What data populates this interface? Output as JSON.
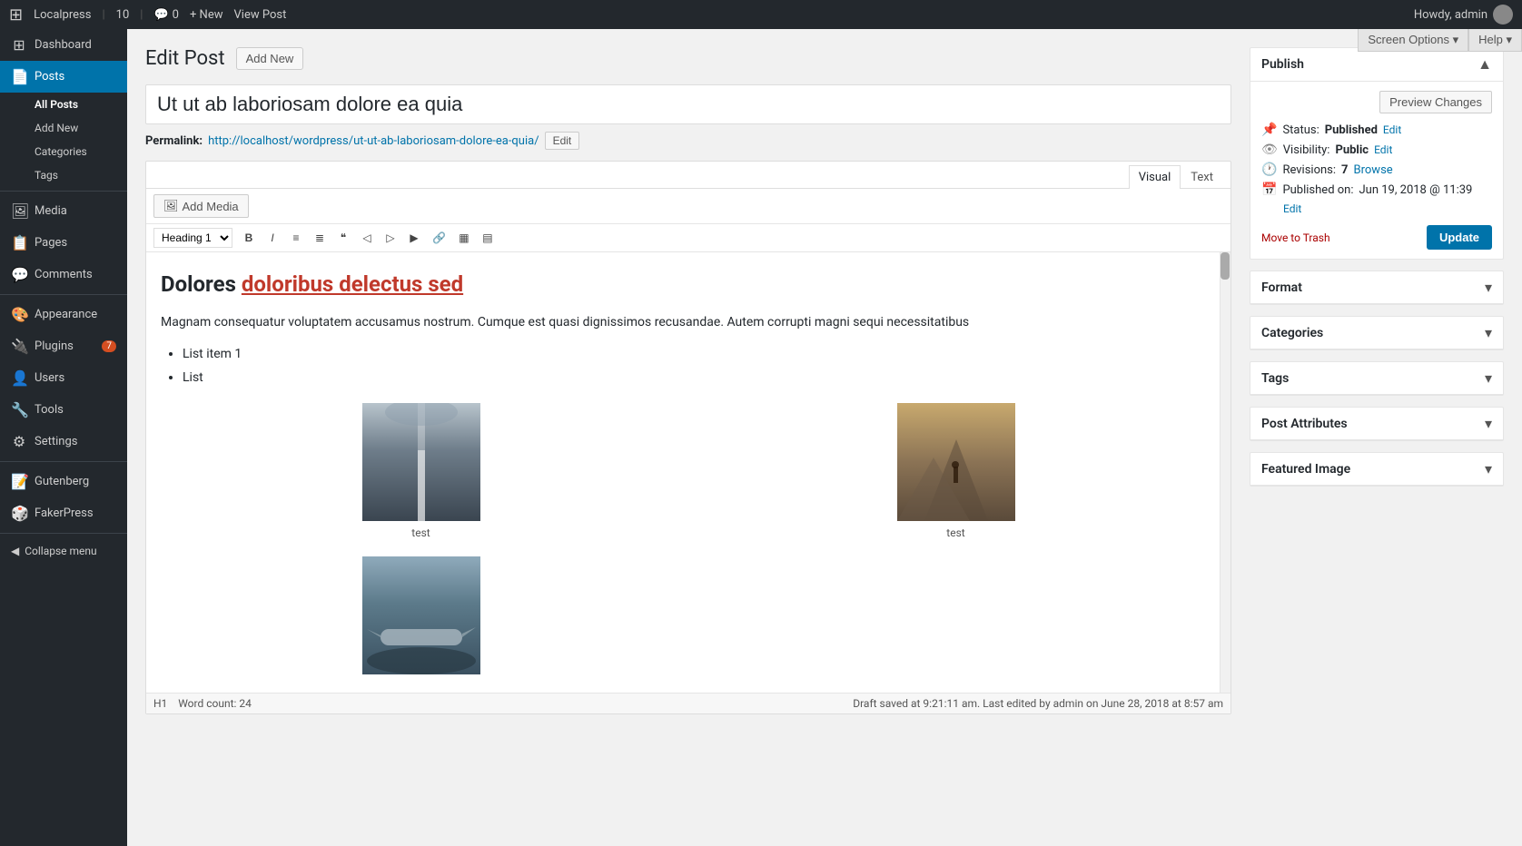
{
  "adminbar": {
    "site_name": "Localpress",
    "update_count": "10",
    "comment_count": "0",
    "new_label": "+ New",
    "view_post_label": "View Post",
    "howdy_label": "Howdy, admin"
  },
  "screen_options": {
    "label": "Screen Options ▾",
    "help_label": "Help ▾"
  },
  "sidebar": {
    "items": [
      {
        "id": "dashboard",
        "label": "Dashboard",
        "icon": "⊞"
      },
      {
        "id": "posts",
        "label": "Posts",
        "icon": "📄",
        "active": true
      },
      {
        "id": "media",
        "label": "Media",
        "icon": "🖼"
      },
      {
        "id": "pages",
        "label": "Pages",
        "icon": "📋"
      },
      {
        "id": "comments",
        "label": "Comments",
        "icon": "💬"
      },
      {
        "id": "appearance",
        "label": "Appearance",
        "icon": "🎨"
      },
      {
        "id": "plugins",
        "label": "Plugins",
        "icon": "🔌",
        "badge": "7"
      },
      {
        "id": "users",
        "label": "Users",
        "icon": "👤"
      },
      {
        "id": "tools",
        "label": "Tools",
        "icon": "🔧"
      },
      {
        "id": "settings",
        "label": "Settings",
        "icon": "⚙"
      },
      {
        "id": "gutenberg",
        "label": "Gutenberg",
        "icon": "📝"
      },
      {
        "id": "fakerpress",
        "label": "FakerPress",
        "icon": "🎲"
      }
    ],
    "submenu": [
      {
        "label": "All Posts",
        "active": true
      },
      {
        "label": "Add New"
      },
      {
        "label": "Categories"
      },
      {
        "label": "Tags"
      }
    ],
    "collapse_label": "Collapse menu"
  },
  "page": {
    "title": "Edit Post",
    "add_new_label": "Add New"
  },
  "post": {
    "title": "Ut ut ab laboriosam dolore ea quia",
    "permalink_label": "Permalink:",
    "permalink_url": "http://localhost/wordpress/ut-ut-ab-laboriosam-dolore-ea-quia/",
    "permalink_edit_label": "Edit",
    "add_media_label": "Add Media",
    "tab_visual": "Visual",
    "tab_text": "Text",
    "format_select": "Heading 1",
    "toolbar_buttons": [
      "B",
      "I",
      "≡",
      "≣",
      "❝",
      "◀",
      "▶",
      "▶▶",
      "🔗",
      "▦",
      "▤"
    ],
    "content_h1": "Dolores ",
    "content_h1_link": "doloribus delectus sed",
    "content_para": "Magnam consequatur voluptatem accusamus nostrum. Cumque est quasi dignissimos recusandae. Autem corrupti magni sequi necessitatibus",
    "list_items": [
      "List item 1",
      "List"
    ],
    "gallery": [
      {
        "caption": "test",
        "type": "road"
      },
      {
        "caption": "test",
        "type": "mountain"
      },
      {
        "caption": "",
        "type": "plane"
      }
    ],
    "statusbar_left": "H1",
    "statusbar_word_count_label": "Word count:",
    "statusbar_word_count": "24",
    "statusbar_right": "Draft saved at 9:21:11 am. Last edited by admin on June 28, 2018 at 8:57 am"
  },
  "publish_box": {
    "title": "Publish",
    "preview_label": "Preview Changes",
    "status_label": "Status:",
    "status_value": "Published",
    "status_edit": "Edit",
    "visibility_label": "Visibility:",
    "visibility_value": "Public",
    "visibility_edit": "Edit",
    "revisions_label": "Revisions:",
    "revisions_count": "7",
    "revisions_browse": "Browse",
    "published_label": "Published on:",
    "published_value": "Jun 19, 2018 @ 11:39",
    "published_edit": "Edit",
    "trash_label": "Move to Trash",
    "update_label": "Update"
  },
  "format_box": {
    "title": "Format",
    "toggle": "▾"
  },
  "categories_box": {
    "title": "Categories",
    "toggle": "▾"
  },
  "tags_box": {
    "title": "Tags",
    "toggle": "▾"
  },
  "post_attributes_box": {
    "title": "Post Attributes",
    "toggle": "▾"
  },
  "featured_image_box": {
    "title": "Featured Image",
    "toggle": "▾"
  }
}
